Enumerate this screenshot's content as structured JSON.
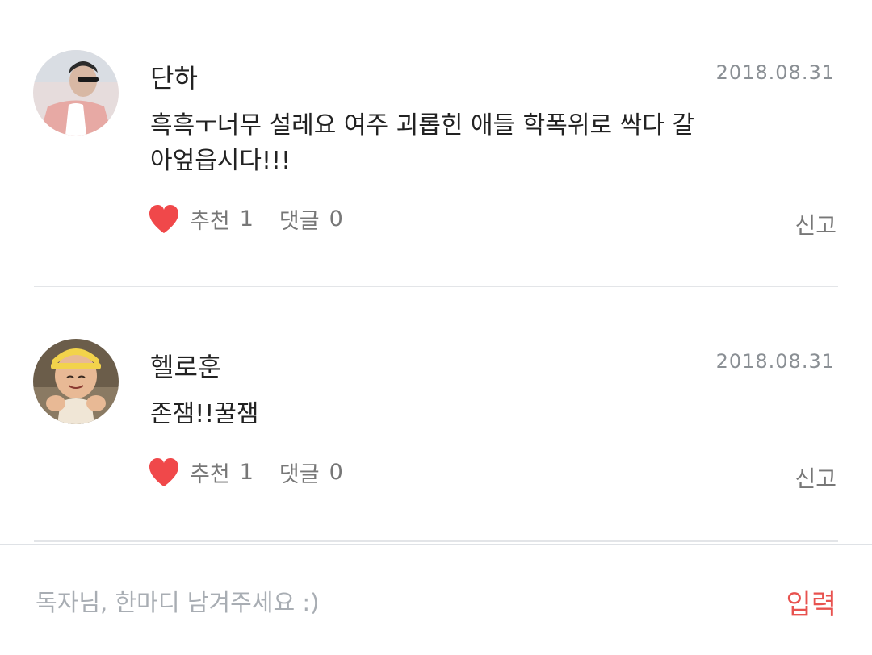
{
  "comments": [
    {
      "author": "단하",
      "date": "2018.08.31",
      "text": "흑흑ㅜ너무 설레요 여주 괴롭힌 애들 학폭위로 싹다 갈아엎읍시다!!!",
      "like_label": "추천",
      "like_count": "1",
      "reply_label": "댓글",
      "reply_count": "0",
      "report_label": "신고",
      "avatar_colors": {
        "bg": "#e8d6d3",
        "jacket": "#e7a9a4",
        "shirt": "#ffffff",
        "hair": "#2b2b2b"
      }
    },
    {
      "author": "헬로훈",
      "date": "2018.08.31",
      "text": "존잼!!꿀잼",
      "like_label": "추천",
      "like_count": "1",
      "reply_label": "댓글",
      "reply_count": "0",
      "report_label": "신고",
      "avatar_colors": {
        "bg": "#6b5d4a",
        "cap": "#f2d34b",
        "face": "#e8b995",
        "shirt": "#f0e6d6"
      }
    }
  ],
  "input": {
    "placeholder": "독자님, 한마디 남겨주세요 :)",
    "value": "",
    "submit_label": "입력"
  },
  "colors": {
    "heart": "#f0484a",
    "submit": "#e8524f",
    "divider": "#e3e5e8",
    "date": "#8a8f94",
    "muted": "#777777"
  },
  "icons": {
    "like": "heart-icon"
  }
}
